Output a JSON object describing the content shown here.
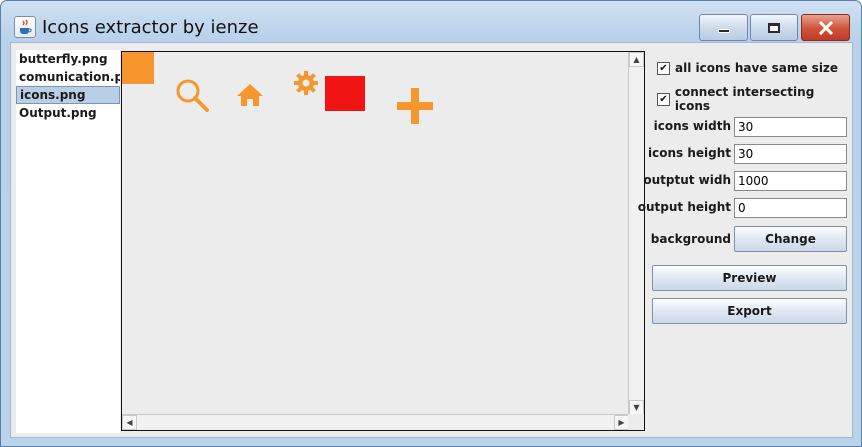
{
  "window": {
    "title": "Icons extractor by ienze"
  },
  "files": [
    {
      "label": "butterfly.png"
    },
    {
      "label": "comunication.png"
    },
    {
      "label": "icons.png"
    },
    {
      "label": "Output.png"
    }
  ],
  "selected_file_index": 2,
  "options": {
    "same_size": {
      "label": "all icons have same size",
      "checked": true,
      "mark": "✔"
    },
    "connect": {
      "label": "connect intersecting icons",
      "checked": true,
      "mark": "✔"
    },
    "icons_width": {
      "label": "icons width",
      "value": "30"
    },
    "icons_height": {
      "label": "icons height",
      "value": "30"
    },
    "output_width": {
      "label": "outptut widh",
      "value": "1000"
    },
    "output_height": {
      "label": "output height",
      "value": "0"
    },
    "background": {
      "label": "background",
      "button": "Change"
    }
  },
  "actions": {
    "preview": "Preview",
    "export": "Export"
  },
  "colors": {
    "icon_orange": "#f7962c",
    "icon_red": "#f11414",
    "accent_blue": "#b8cfe5"
  },
  "canvas_icons": [
    "orange-square",
    "search",
    "home",
    "gear",
    "red-rectangle",
    "plus"
  ]
}
